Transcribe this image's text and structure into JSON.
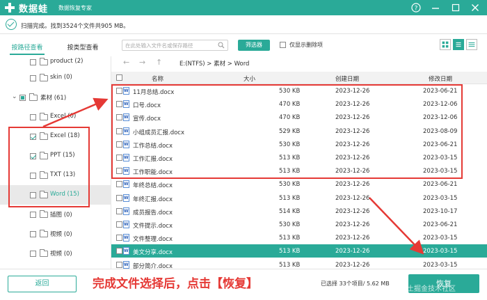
{
  "title_bar": {
    "app_name": "数据蛙",
    "subtitle": "数据恢复专家"
  },
  "status": {
    "text": "扫描完成。找到3524个文件共905 MB。"
  },
  "tabs": [
    {
      "label": "按路径查看",
      "active": true
    },
    {
      "label": "按类型查看",
      "active": false
    }
  ],
  "tree": [
    {
      "label": "product (2)",
      "checked": false,
      "selected": false
    },
    {
      "label": "skin (0)",
      "checked": false,
      "selected": false
    },
    {
      "label": "素材 (61)",
      "checked": "partial",
      "expanded": true,
      "selected": false
    },
    {
      "label": "Excel (0)",
      "checked": false,
      "selected": false
    },
    {
      "label": "Excel (18)",
      "checked": true,
      "selected": false
    },
    {
      "label": "PPT (15)",
      "checked": true,
      "selected": false
    },
    {
      "label": "TXT (13)",
      "checked": false,
      "selected": false
    },
    {
      "label": "Word (15)",
      "checked": false,
      "selected": true
    },
    {
      "label": "插图 (0)",
      "checked": false,
      "selected": false
    },
    {
      "label": "视频 (0)",
      "checked": false,
      "selected": false
    },
    {
      "label": "视频 (0)",
      "checked": false,
      "selected": false
    }
  ],
  "toolbar": {
    "search_placeholder": "在此处输入文件名或保存路径",
    "filter_label": "筛选器",
    "deleted_only_label": "仅显示删除项"
  },
  "breadcrumb": "E:(NTFS) > 素材 > Word",
  "table": {
    "headers": {
      "name": "名称",
      "size": "大小",
      "created": "创建日期",
      "modified": "修改日期"
    },
    "rows": [
      {
        "name": "11月总结.docx",
        "size": "530 KB",
        "created": "2023-12-26",
        "modified": "2023-06-21",
        "selected": false
      },
      {
        "name": "口号.docx",
        "size": "470 KB",
        "created": "2023-12-26",
        "modified": "2023-12-06",
        "selected": false
      },
      {
        "name": "宣传.docx",
        "size": "470 KB",
        "created": "2023-12-26",
        "modified": "2023-12-06",
        "selected": false
      },
      {
        "name": "小组成员汇报.docx",
        "size": "529 KB",
        "created": "2023-12-26",
        "modified": "2023-08-09",
        "selected": false
      },
      {
        "name": "工作总结.docx",
        "size": "530 KB",
        "created": "2023-12-26",
        "modified": "2023-06-21",
        "selected": false
      },
      {
        "name": "工作汇报.docx",
        "size": "513 KB",
        "created": "2023-12-26",
        "modified": "2023-03-15",
        "selected": false
      },
      {
        "name": "工作职能.docx",
        "size": "513 KB",
        "created": "2023-12-26",
        "modified": "2023-03-15",
        "selected": false
      },
      {
        "name": "年终总结.docx",
        "size": "530 KB",
        "created": "2023-12-26",
        "modified": "2023-06-21",
        "selected": false
      },
      {
        "name": "年终汇报.docx",
        "size": "513 KB",
        "created": "2023-12-26",
        "modified": "2023-03-15",
        "selected": false
      },
      {
        "name": "成员报告.docx",
        "size": "514 KB",
        "created": "2023-12-26",
        "modified": "2023-10-17",
        "selected": false
      },
      {
        "name": "文件提示.docx",
        "size": "530 KB",
        "created": "2023-12-26",
        "modified": "2023-06-21",
        "selected": false
      },
      {
        "name": "文件整理.docx",
        "size": "513 KB",
        "created": "2023-12-26",
        "modified": "2023-03-15",
        "selected": false
      },
      {
        "name": "美文分享.docx",
        "size": "513 KB",
        "created": "2023-12-26",
        "modified": "2023-03-15",
        "selected": true
      },
      {
        "name": "部分简介.docx",
        "size": "513 KB",
        "created": "2023-12-26",
        "modified": "2023-03-15",
        "selected": false
      }
    ]
  },
  "bottom": {
    "back_label": "返回",
    "annotation": "完成文件选择后，点击【恢复】",
    "selection_info": "已选择 33个项目/ 5.62 MB",
    "restore_label": "恢复"
  },
  "watermark": "@稀土掘金技术社区",
  "colors": {
    "brand": "#2aaa98",
    "annotation_red": "#e53935"
  }
}
